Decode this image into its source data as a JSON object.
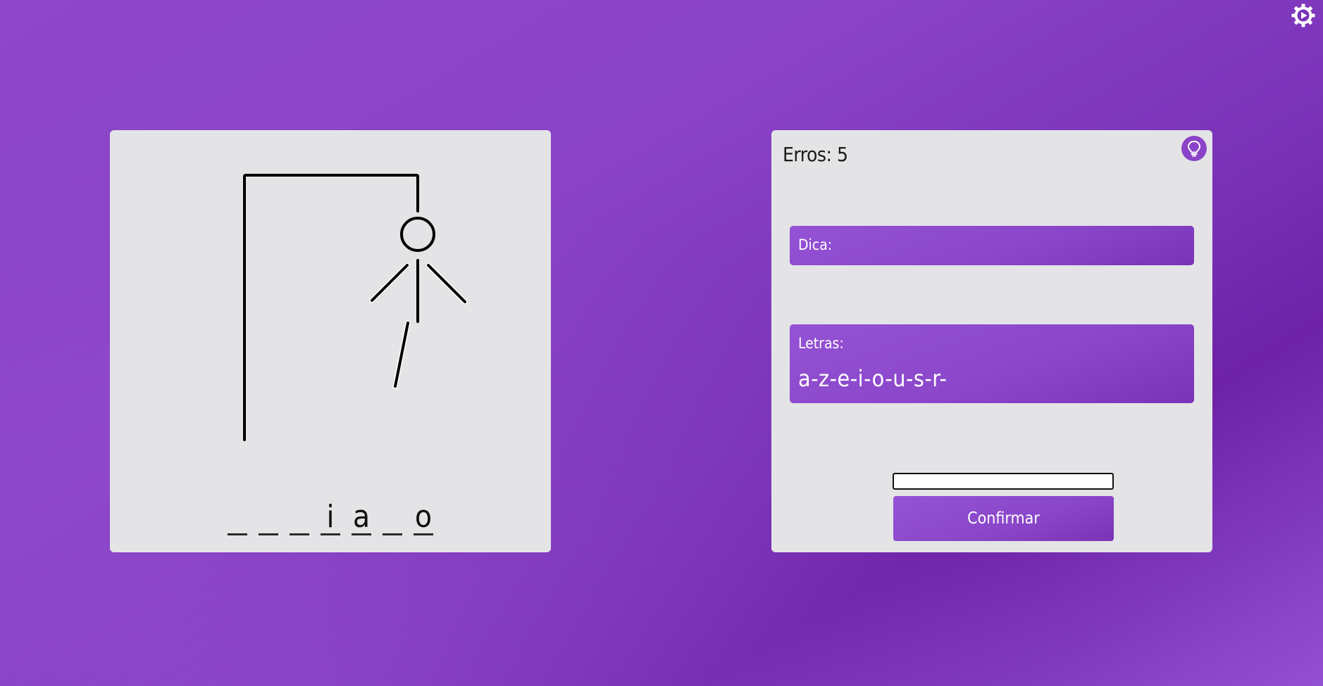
{
  "settings": {
    "icon": "gear-play-icon"
  },
  "game": {
    "word_slots": [
      "",
      "",
      "",
      "i",
      "a",
      "",
      "o"
    ],
    "hangman_parts": [
      "head",
      "body",
      "left-arm",
      "right-arm",
      "left-leg"
    ]
  },
  "info": {
    "errors_text": "Erros: 5",
    "hint_icon": "lightbulb-icon",
    "hint_label": "Dica:",
    "letters_label": "Letras:",
    "letters_value": "a-z-e-i-o-u-s-r-",
    "input_value": "",
    "confirm_label": "Confirmar"
  },
  "colors": {
    "accent": "#8a43c7",
    "card": "#e4e4e6",
    "ink": "#111111"
  }
}
